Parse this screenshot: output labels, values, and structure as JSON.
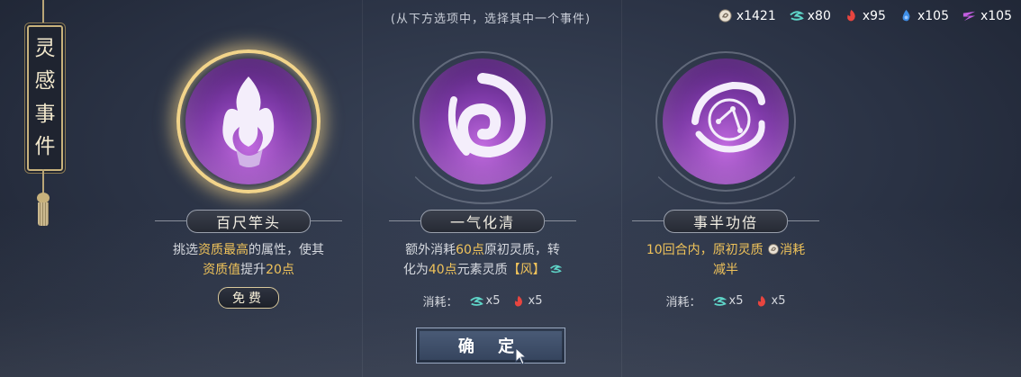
{
  "banner": {
    "title_chars": [
      "灵",
      "感",
      "事",
      "件"
    ]
  },
  "hint": "(从下方选项中，选择其中一个事件)",
  "resources": [
    {
      "icon": "origin-essence-icon",
      "value": "x1421",
      "color": "#e8ddd0"
    },
    {
      "icon": "wind-element-icon",
      "value": "x80",
      "color": "#5fd6c9"
    },
    {
      "icon": "fire-element-icon",
      "value": "x95",
      "color": "#e8453f"
    },
    {
      "icon": "water-element-icon",
      "value": "x105",
      "color": "#3f8fe8"
    },
    {
      "icon": "thunder-element-icon",
      "value": "x105",
      "color": "#c25ee0"
    }
  ],
  "cards": [
    {
      "title": "百尺竿头",
      "icon": "flame-hand-icon",
      "selected": true,
      "desc_lines": [
        [
          {
            "t": "挑选",
            "g": false
          },
          {
            "t": "资质最高",
            "g": true
          },
          {
            "t": "的属性，使其",
            "g": false
          }
        ],
        [
          {
            "t": "资质值",
            "g": true
          },
          {
            "t": "提升",
            "g": false
          },
          {
            "t": "20点",
            "g": true
          }
        ]
      ],
      "cost_label": "免费"
    },
    {
      "title": "一气化清",
      "icon": "swirl-icon",
      "selected": false,
      "desc_lines": [
        [
          {
            "t": "额外消耗",
            "g": false
          },
          {
            "t": "60点",
            "g": true
          },
          {
            "t": "原初灵质，转",
            "g": false
          }
        ],
        [
          {
            "t": "化为",
            "g": false
          },
          {
            "t": "40点",
            "g": true
          },
          {
            "t": "元素灵质",
            "g": false
          },
          {
            "t": "【风】",
            "g": true
          }
        ]
      ],
      "cost_label": "消耗：",
      "costs": [
        {
          "icon": "wind-element-icon",
          "value": "x5"
        },
        {
          "icon": "fire-element-icon",
          "value": "x5"
        }
      ]
    },
    {
      "title": "事半功倍",
      "icon": "clock-swirl-icon",
      "selected": false,
      "desc_lines": [
        [
          {
            "t": "10回合内，",
            "g": true
          },
          {
            "t": "原初灵质",
            "g": true
          },
          {
            "t": "消耗",
            "g": true
          }
        ],
        [
          {
            "t": "减半",
            "g": true
          }
        ]
      ],
      "cost_label": "消耗：",
      "costs": [
        {
          "icon": "wind-element-icon",
          "value": "x5"
        },
        {
          "icon": "fire-element-icon",
          "value": "x5"
        }
      ]
    }
  ],
  "confirm_label": "确 定"
}
